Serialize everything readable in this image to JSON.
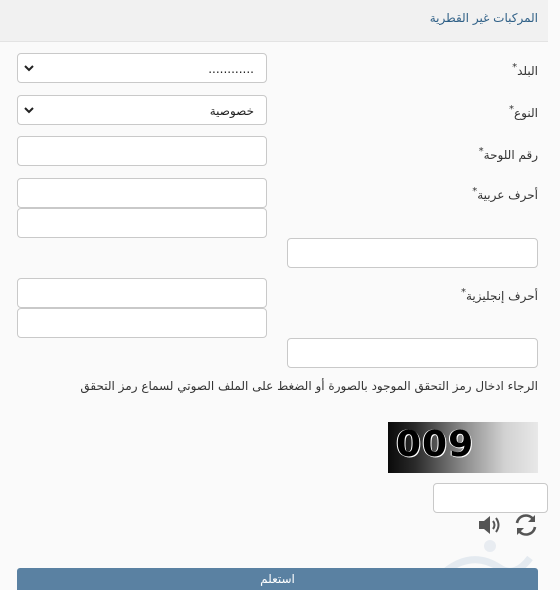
{
  "header": {
    "title": "المركبات غير القطرية"
  },
  "form": {
    "country": {
      "label": "البلد",
      "required_mark": "*",
      "value": "............"
    },
    "type": {
      "label": "النوع",
      "required_mark": "*",
      "value": "خصوصية"
    },
    "plate_number": {
      "label": "رقم اللوحة",
      "required_mark": "*",
      "value": ""
    },
    "arabic_letters": {
      "label": "أحرف عربية",
      "required_mark": "*",
      "value_1": "",
      "value_2": "",
      "value_3": ""
    },
    "english_letters": {
      "label": "أحرف إنجليزية",
      "required_mark": "*",
      "value_1": "",
      "value_2": "",
      "value_3": ""
    }
  },
  "captcha": {
    "instruction": "الرجاء ادخال رمز التحقق الموجود بالصورة أو الضغط على الملف الصوتي لسماع رمز التحقق",
    "image_text": "009",
    "input_value": "",
    "audio_icon": "speaker-icon",
    "refresh_icon": "refresh-icon"
  },
  "submit": {
    "label": "استعلم"
  },
  "colors": {
    "title": "#2e5f86",
    "button": "#5a81a2",
    "header_bg": "#f1f1f1"
  }
}
